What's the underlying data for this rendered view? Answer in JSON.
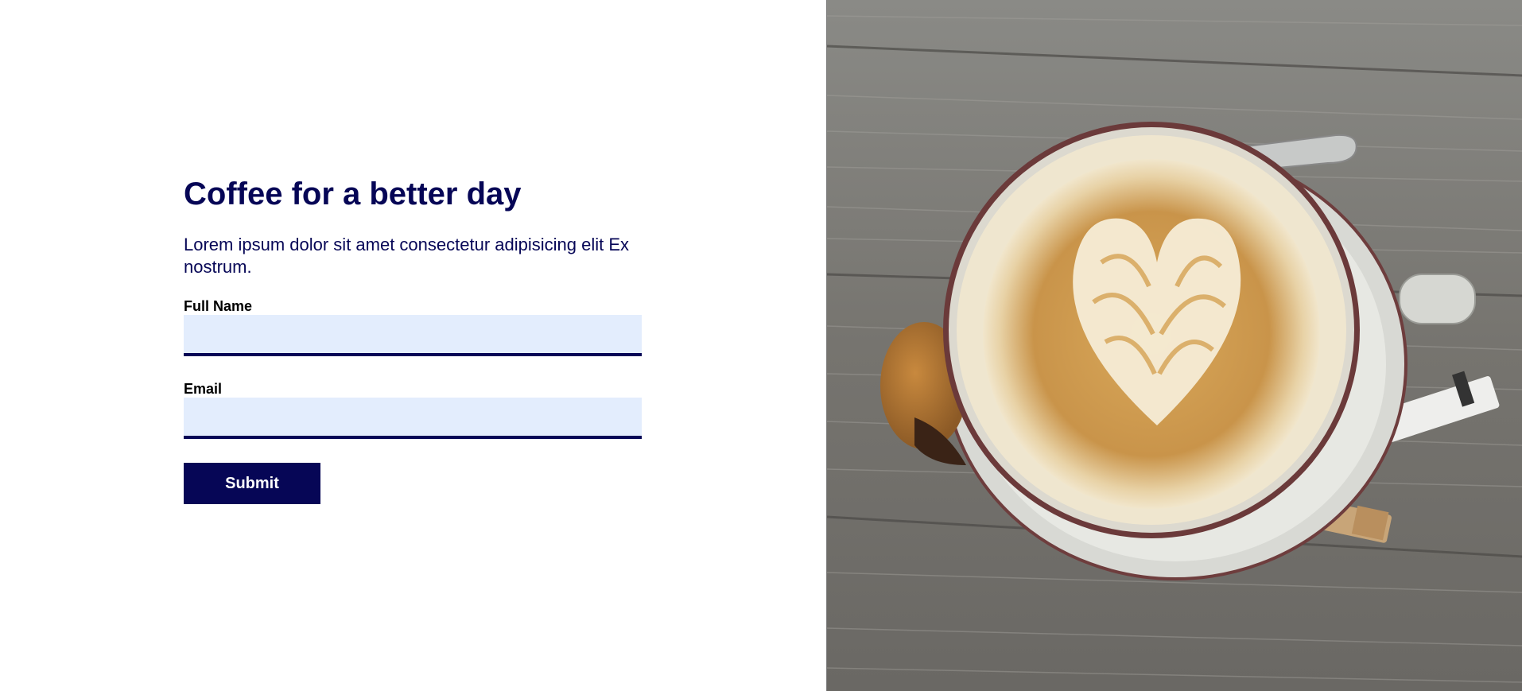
{
  "form": {
    "title": "Coffee for a better day",
    "description": "Lorem ipsum dolor sit amet consectetur adipisicing elit Ex nostrum.",
    "fields": [
      {
        "label": "Full Name",
        "value": "",
        "placeholder": ""
      },
      {
        "label": "Email",
        "value": "",
        "placeholder": ""
      }
    ],
    "submit_label": "Submit"
  },
  "colors": {
    "brand_navy": "#060656",
    "input_background": "#e3edfd",
    "page_background": "#ffffff"
  },
  "hero": {
    "image_description_icon": "coffee-cup-photo"
  }
}
